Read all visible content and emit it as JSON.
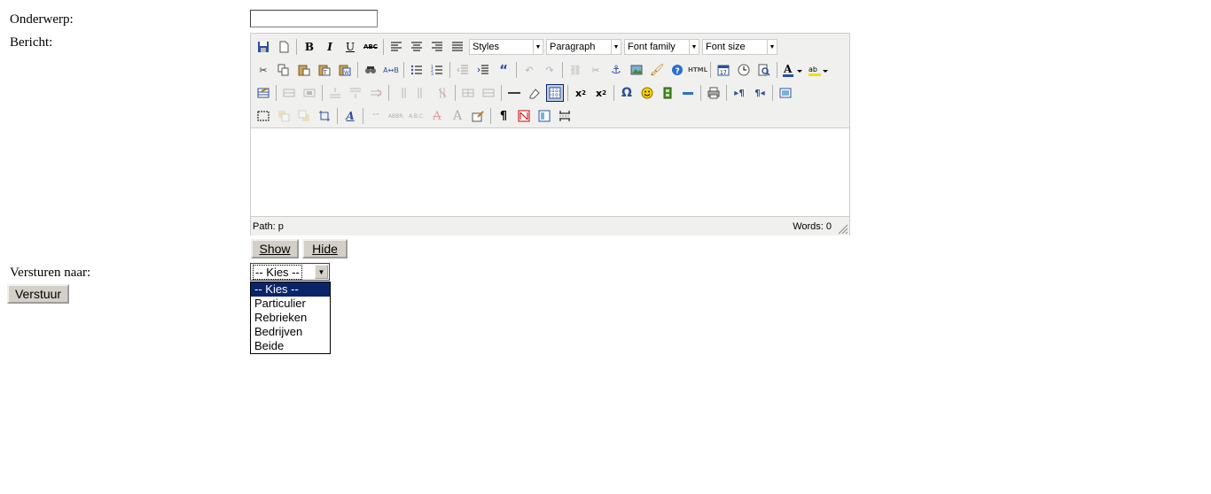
{
  "form": {
    "subject_label": "Onderwerp:",
    "message_label": "Bericht:",
    "recipient_label": "Versturen naar:",
    "subject_value": "",
    "submit_label": "Verstuur"
  },
  "editor": {
    "styles_label": "Styles",
    "format_label": "Paragraph",
    "fontfamily_label": "Font family",
    "fontsize_label": "Font size",
    "path_text": "Path: p",
    "words_text": "Words: 0",
    "toolbar_icons_row1": [
      "save-icon",
      "new-document-icon",
      "bold-icon",
      "italic-icon",
      "underline-icon",
      "strikethrough-icon",
      "align-left-icon",
      "align-center-icon",
      "align-right-icon",
      "align-justify-icon"
    ],
    "toolbar_icons_row2": [
      "cut-icon",
      "copy-icon",
      "paste-icon",
      "paste-text-icon",
      "paste-word-icon",
      "find-icon",
      "replace-icon",
      "bullet-list-icon",
      "numbered-list-icon",
      "outdent-icon",
      "indent-icon",
      "blockquote-icon",
      "undo-icon",
      "redo-icon",
      "link-icon",
      "unlink-icon",
      "anchor-icon",
      "image-icon",
      "cleanup-icon",
      "help-icon",
      "html-icon",
      "insert-date-icon",
      "insert-time-icon",
      "preview-icon",
      "text-color-icon",
      "highlight-color-icon"
    ],
    "toolbar_icons_row3": [
      "table-icon",
      "row-props-icon",
      "cell-props-icon",
      "insert-row-before-icon",
      "insert-row-after-icon",
      "delete-row-icon",
      "insert-col-before-icon",
      "insert-col-after-icon",
      "delete-col-icon",
      "split-cells-icon",
      "merge-cells-icon",
      "horizontal-rule-icon",
      "remove-format-icon",
      "visual-aid-icon",
      "subscript-icon",
      "superscript-icon",
      "special-char-icon",
      "emoticon-icon",
      "media-icon",
      "advanced-hr-icon",
      "print-icon",
      "ltr-icon",
      "rtl-icon",
      "fullscreen-icon"
    ],
    "toolbar_icons_row4": [
      "insert-layer-icon",
      "move-forward-icon",
      "move-backward-icon",
      "absolute-icon",
      "styleprops-icon",
      "cite-icon",
      "abbr-icon",
      "acronym-icon",
      "del-icon",
      "ins-icon",
      "attribs-icon",
      "visualchars-icon",
      "nonbreaking-icon",
      "template-icon",
      "pagebreak-icon"
    ]
  },
  "toggle_buttons": {
    "show_label": "Show",
    "hide_label": "Hide"
  },
  "recipient_select": {
    "selected": "-- Kies --",
    "options": [
      "-- Kies --",
      "Particulier",
      "Rebrieken",
      "Bedrijven",
      "Beide"
    ]
  },
  "colors": {
    "selection": "#0a246a",
    "toolbar_bg": "#f0f0ee",
    "button_face": "#d4d0c8"
  }
}
